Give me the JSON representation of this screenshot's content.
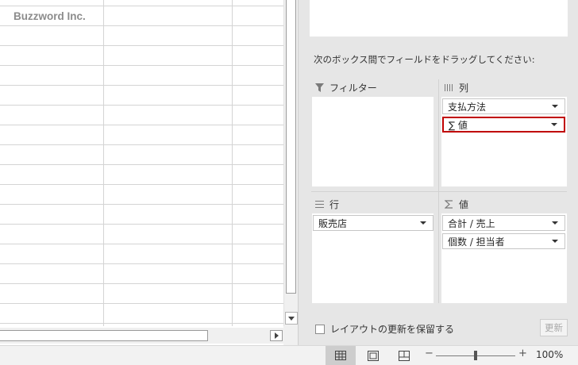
{
  "sheet": {
    "cell_text": "Buzzword Inc."
  },
  "pivot": {
    "instructions": "次のボックス間でフィールドをドラッグしてください:",
    "areas": {
      "filter": {
        "title": "フィルター",
        "icon": "filter-icon"
      },
      "columns": {
        "title": "列",
        "icon": "columns-icon",
        "fields": [
          {
            "label": "支払方法"
          },
          {
            "label": "∑ 値"
          }
        ]
      },
      "rows": {
        "title": "行",
        "icon": "rows-icon",
        "fields": [
          {
            "label": "販売店"
          }
        ]
      },
      "values": {
        "title": "値",
        "icon": "sigma-icon",
        "fields": [
          {
            "label": "合計 / 売上"
          },
          {
            "label": "個数 / 担当者"
          }
        ]
      }
    },
    "defer_update_label": "レイアウトの更新を保留する",
    "defer_update_checked": false,
    "update_button": "更新"
  },
  "status_bar": {
    "zoom_minus": "−",
    "zoom_plus": "+",
    "zoom_level": "100%"
  },
  "colors": {
    "selected_border": "#c00000",
    "pane_background": "#e6e6e6"
  }
}
